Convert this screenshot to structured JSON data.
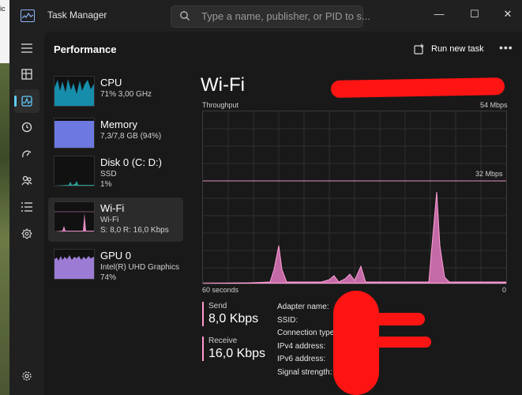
{
  "window": {
    "title": "Task Manager",
    "search_placeholder": "Type a name, publisher, or PID to s..."
  },
  "winbuttons": {
    "minimize": "—",
    "maximize": "☐",
    "close": "✕"
  },
  "header": {
    "section": "Performance",
    "run_new_task": "Run new task",
    "more": "•••"
  },
  "nav": {
    "items": [
      "hamburger-icon",
      "processes-icon",
      "performance-icon",
      "app-history-icon",
      "startup-apps-icon",
      "users-icon",
      "details-icon",
      "services-icon"
    ],
    "settings": "settings-icon",
    "active": "performance"
  },
  "devices": [
    {
      "name": "CPU",
      "sub1": "71%  3,00 GHz",
      "sub2": "",
      "sub3": "",
      "color": "#17a3c7"
    },
    {
      "name": "Memory",
      "sub1": "7,3/7,8 GB (94%)",
      "sub2": "",
      "sub3": "",
      "color": "#7f8cff"
    },
    {
      "name": "Disk 0 (C: D:)",
      "sub1": "SSD",
      "sub2": "1%",
      "sub3": "",
      "color": "#2aa198"
    },
    {
      "name": "Wi-Fi",
      "sub1": "Wi-Fi",
      "sub2": "S: 8,0  R: 16,0 Kbps",
      "sub3": "",
      "color": "#e58cc4"
    },
    {
      "name": "GPU 0",
      "sub1": "Intel(R) UHD Graphics",
      "sub2": "74%",
      "sub3": "",
      "color": "#b38ae3"
    }
  ],
  "detail": {
    "title": "Wi-Fi",
    "throughput_label": "Throughput",
    "max_label": "54 Mbps",
    "mid_label": "32 Mbps",
    "axis_left": "60 seconds",
    "axis_right": "0",
    "send_label": "Send",
    "send_value": "8,0 Kbps",
    "receive_label": "Receive",
    "receive_value": "16,0 Kbps",
    "properties": [
      "Adapter name:",
      "SSID:",
      "Connection type:",
      "IPv4 address:",
      "IPv6 address:",
      "Signal strength:"
    ]
  },
  "colors": {
    "accent": "#60cdff",
    "wifi": "#e58cc4",
    "redaction": "#ff1414"
  }
}
